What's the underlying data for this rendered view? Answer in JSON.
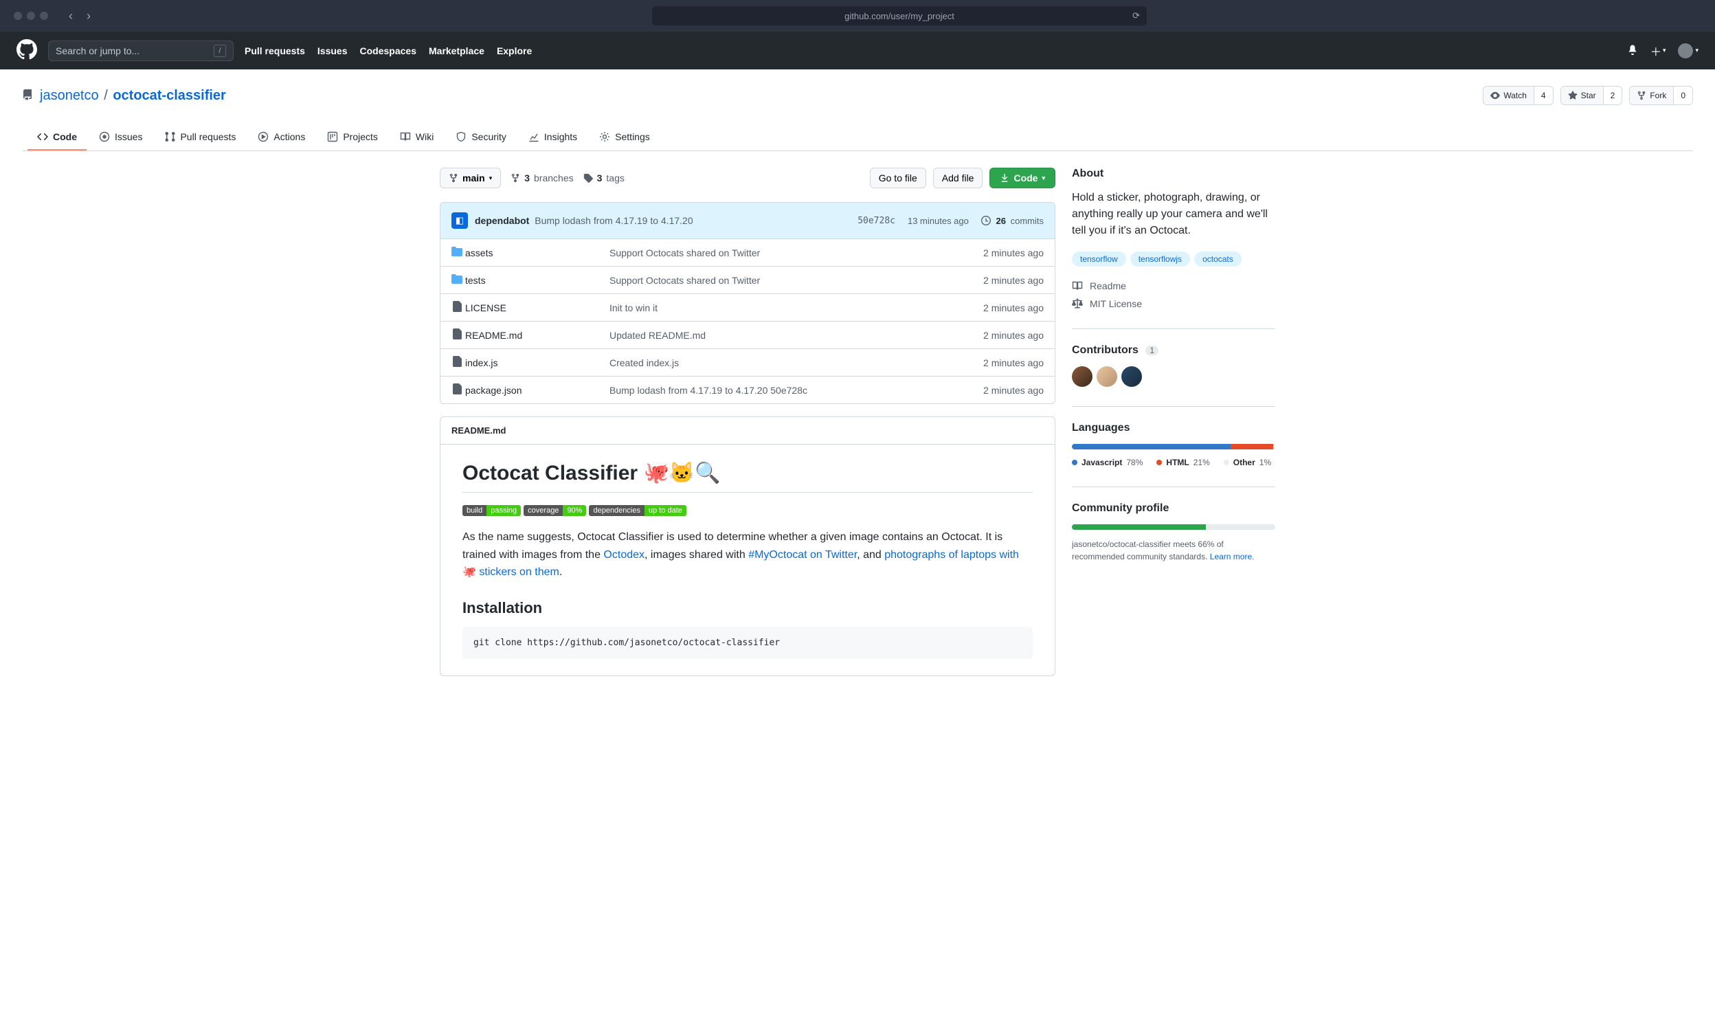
{
  "browser": {
    "url": "github.com/user/my_project"
  },
  "header": {
    "search_placeholder": "Search or jump to...",
    "nav": [
      "Pull requests",
      "Issues",
      "Codespaces",
      "Marketplace",
      "Explore"
    ]
  },
  "repo": {
    "owner": "jasonetco",
    "name": "octocat-classifier",
    "watch_label": "Watch",
    "watch_count": "4",
    "star_label": "Star",
    "star_count": "2",
    "fork_label": "Fork",
    "fork_count": "0"
  },
  "tabs": [
    {
      "label": "Code",
      "active": true
    },
    {
      "label": "Issues"
    },
    {
      "label": "Pull requests"
    },
    {
      "label": "Actions"
    },
    {
      "label": "Projects"
    },
    {
      "label": "Wiki"
    },
    {
      "label": "Security"
    },
    {
      "label": "Insights"
    },
    {
      "label": "Settings"
    }
  ],
  "file_nav": {
    "branch": "main",
    "branches_count": "3",
    "branches_label": "branches",
    "tags_count": "3",
    "tags_label": "tags",
    "go_to_file": "Go to file",
    "add_file": "Add file",
    "code": "Code"
  },
  "latest_commit": {
    "author": "dependabot",
    "message": "Bump lodash from 4.17.19 to 4.17.20",
    "sha": "50e728c",
    "time": "13 minutes ago",
    "commits_count": "26",
    "commits_label": "commits"
  },
  "files": [
    {
      "type": "dir",
      "name": "assets",
      "msg": "Support Octocats shared on Twitter",
      "time": "2 minutes ago"
    },
    {
      "type": "dir",
      "name": "tests",
      "msg": "Support Octocats shared on Twitter",
      "time": "2 minutes ago"
    },
    {
      "type": "file",
      "name": "LICENSE",
      "msg": "Init to win it",
      "time": "2 minutes ago"
    },
    {
      "type": "file",
      "name": "README.md",
      "msg": "Updated README.md",
      "time": "2 minutes ago"
    },
    {
      "type": "file",
      "name": "index.js",
      "msg": "Created index.js",
      "time": "2 minutes ago"
    },
    {
      "type": "file",
      "name": "package.json",
      "msg": "Bump lodash from 4.17.19 to 4.17.20 50e728c",
      "time": "2 minutes ago"
    }
  ],
  "readme": {
    "filename": "README.md",
    "title": "Octocat Classifier 🐙🐱🔍",
    "badges": [
      {
        "k": "build",
        "v": "passing"
      },
      {
        "k": "coverage",
        "v": "90%"
      },
      {
        "k": "dependencies",
        "v": "up to date"
      }
    ],
    "intro_1": "As the name suggests, Octocat Classifier is used to determine whether a given image contains an Octocat. It is trained with images from the ",
    "link_octodex": "Octodex",
    "intro_2": ", images shared with ",
    "link_hashtag": "#MyOctocat on Twitter",
    "intro_3": ", and ",
    "link_photos": "photographs of laptops with 🐙 stickers on them",
    "intro_4": ".",
    "install_heading": "Installation",
    "install_cmd": "git clone https://github.com/jasonetco/octocat-classifier"
  },
  "sidebar": {
    "about_title": "About",
    "about_desc": "Hold a sticker, photograph, drawing, or anything really up your camera and we'll tell you if it's an Octocat.",
    "topics": [
      "tensorflow",
      "tensorflowjs",
      "octocats"
    ],
    "readme_label": "Readme",
    "license_label": "MIT License",
    "contributors_title": "Contributors",
    "contributors_count": "1",
    "languages_title": "Languages",
    "languages": [
      {
        "name": "Javascript",
        "pct": "78%",
        "color": "#3178c6",
        "width": 78
      },
      {
        "name": "HTML",
        "pct": "21%",
        "color": "#e34c26",
        "width": 21
      },
      {
        "name": "Other",
        "pct": "1%",
        "color": "#ededed",
        "width": 1
      }
    ],
    "community_title": "Community profile",
    "community_pct": 66,
    "community_text_1": "jasonetco/octocat-classifier meets 66% of recommended community standards. ",
    "community_link": "Learn more",
    "community_text_2": "."
  }
}
